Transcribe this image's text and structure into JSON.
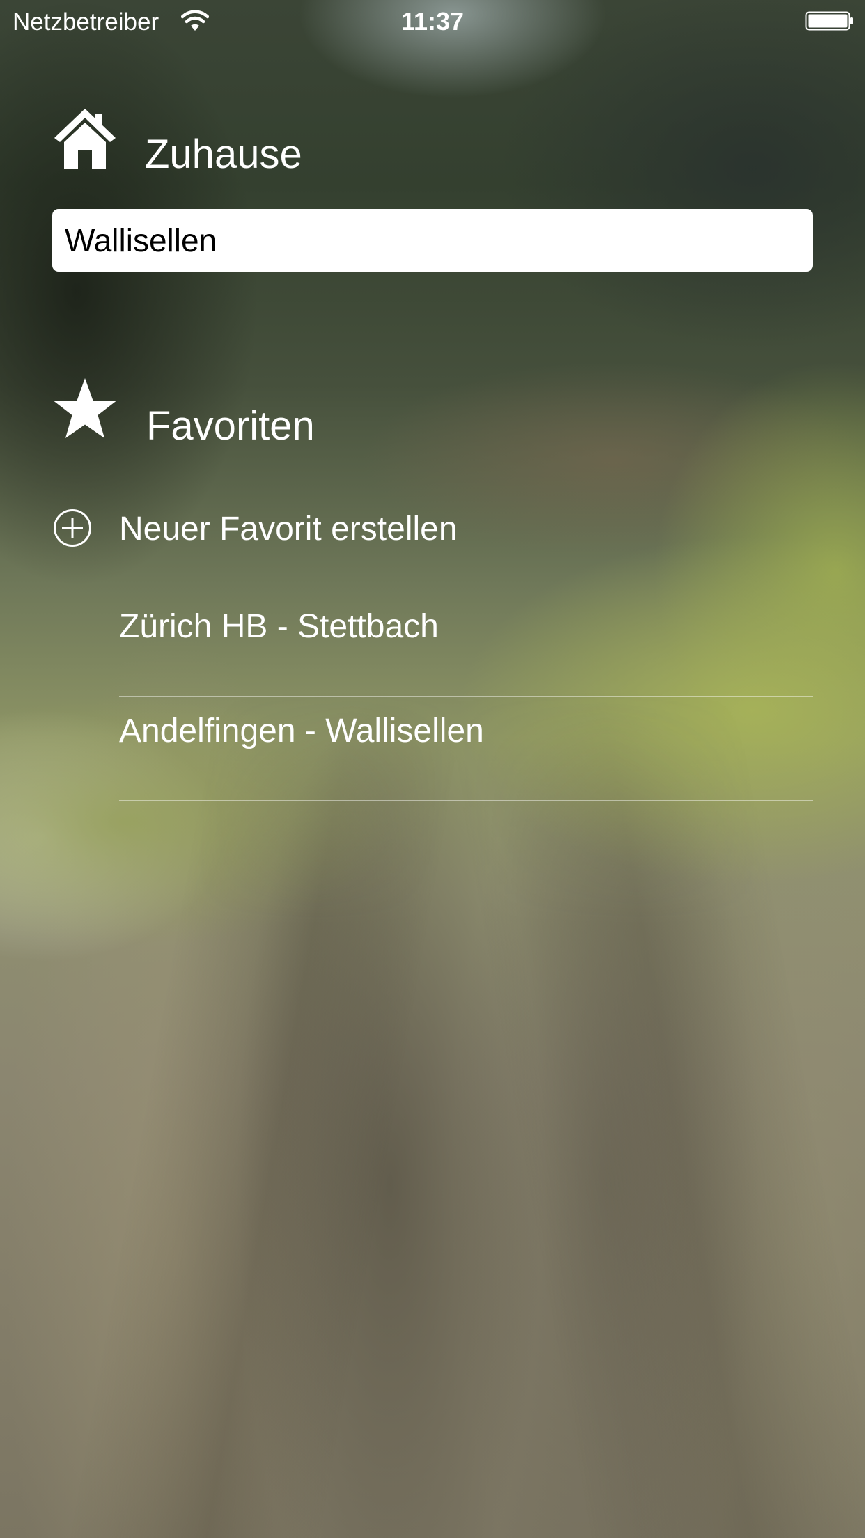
{
  "status_bar": {
    "carrier": "Netzbetreiber",
    "time": "11:37",
    "icons": [
      "wifi-icon",
      "battery-icon"
    ]
  },
  "home": {
    "icon": "home-icon",
    "title": "Zuhause",
    "input_value": "Wallisellen"
  },
  "favorites": {
    "icon": "star-icon",
    "title": "Favoriten",
    "add_icon": "plus-circle-icon",
    "add_label": "Neuer Favorit erstellen",
    "items": [
      {
        "label": "Zürich HB - Stettbach"
      },
      {
        "label": "Andelfingen - Wallisellen"
      }
    ]
  },
  "colors": {
    "text": "#ffffff",
    "input_background": "#ffffff",
    "input_text": "#000000",
    "separator": "rgba(255,255,255,0.45)"
  }
}
